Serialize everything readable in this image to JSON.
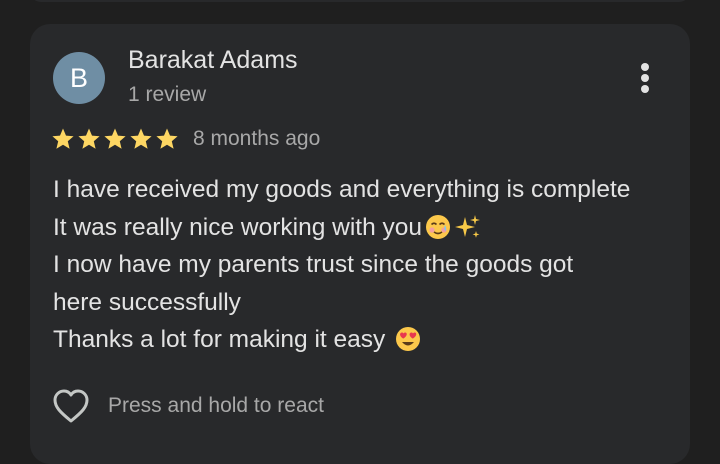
{
  "review": {
    "avatar_letter": "B",
    "reviewer_name": "Barakat Adams",
    "reviewer_meta": "1 review",
    "rating": 5,
    "rating_max": 5,
    "time_ago": "8 months ago",
    "body_lines": [
      "I have received my goods and everything is complete",
      "It was really nice working with you",
      "I now have my parents trust since the goods got",
      "here successfully",
      "Thanks a lot for making it easy "
    ],
    "react_label": "Press and hold to react"
  },
  "icons": {
    "menu": "more-vert-icon",
    "react": "heart-outline-icon",
    "star": "star-icon",
    "emoji_1": "smiling-face-with-tear-emoji",
    "emoji_2": "sparkles-emoji",
    "emoji_3": "heart-eyes-emoji"
  },
  "colors": {
    "background": "#1f1f1f",
    "card": "#28292b",
    "avatar": "#6f8ea4",
    "star": "#fdd663",
    "text_primary": "#e3e3e3",
    "text_secondary": "#a8a8a8"
  }
}
